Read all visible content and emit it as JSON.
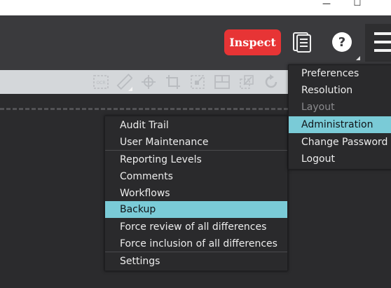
{
  "window": {
    "minimize_glyph": "—",
    "maximize_glyph": "☐"
  },
  "header": {
    "inspect_label": "Inspect",
    "help_glyph": "?",
    "icons": [
      "notes-icon",
      "help-icon",
      "hamburger-menu-icon"
    ],
    "accent_color": "#e73435"
  },
  "toolbar": {
    "icons": [
      "ocr-icon",
      "ruler-icon",
      "crosshair-icon",
      "crop-icon",
      "resize-icon",
      "grid-layout-icon",
      "compare-icon",
      "refresh-icon"
    ]
  },
  "left_menu": {
    "items": [
      {
        "label": "Audit Trail"
      },
      {
        "label": "User Maintenance"
      },
      {
        "label": "Reporting Levels"
      },
      {
        "label": "Comments"
      },
      {
        "label": "Workflows"
      },
      {
        "label": "Backup",
        "highlighted": true
      },
      {
        "label": "Force review of all differences"
      },
      {
        "label": "Force inclusion of all differences"
      },
      {
        "label": "Settings"
      }
    ]
  },
  "right_menu": {
    "items": [
      {
        "label": "Preferences"
      },
      {
        "label": "Resolution"
      },
      {
        "label": "Layout",
        "disabled": true
      },
      {
        "label": "Administration",
        "highlighted": true
      },
      {
        "label": "Change Password"
      },
      {
        "label": "Logout"
      }
    ]
  },
  "highlight_color": "#7acbd7"
}
